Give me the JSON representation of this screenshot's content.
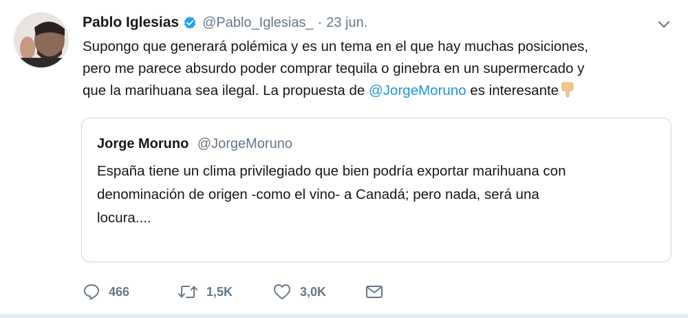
{
  "tweet": {
    "author_name": "Pablo Iglesias",
    "author_handle": "@Pablo_Iglesias_",
    "separator": "·",
    "time": "23 jun.",
    "text_line1": "Supongo que generará polémica y es un tema en el que hay muchas posiciones,",
    "text_line2": "pero me parece absurdo poder comprar tequila o ginebra en un supermercado y",
    "text_line3_prefix": "que la marihuana sea ilegal. La propuesta de ",
    "text_line3_mention": "@JorgeMoruno",
    "text_line3_suffix": " es interesante"
  },
  "quoted": {
    "author_name": "Jorge Moruno",
    "author_handle": "@JorgeMoruno",
    "text_line1": "España tiene un clima privilegiado que bien podría exportar marihuana con",
    "text_line2": "denominación de origen -como el vino- a Canadá; pero nada, será una",
    "text_line3": "locura...."
  },
  "actions": {
    "replies": "466",
    "retweets": "1,5K",
    "likes": "3,0K"
  },
  "icons": {
    "verified": "verified-badge-icon",
    "caret": "chevron-down-icon",
    "reply": "reply-icon",
    "retweet": "retweet-icon",
    "like": "heart-icon",
    "dm": "envelope-icon",
    "emoji": "backhand-index-pointing-down-icon"
  },
  "colors": {
    "mention": "#1b95e0",
    "secondary_text": "#657786",
    "verified": "#1da1f2",
    "border": "#ccd6dd"
  }
}
